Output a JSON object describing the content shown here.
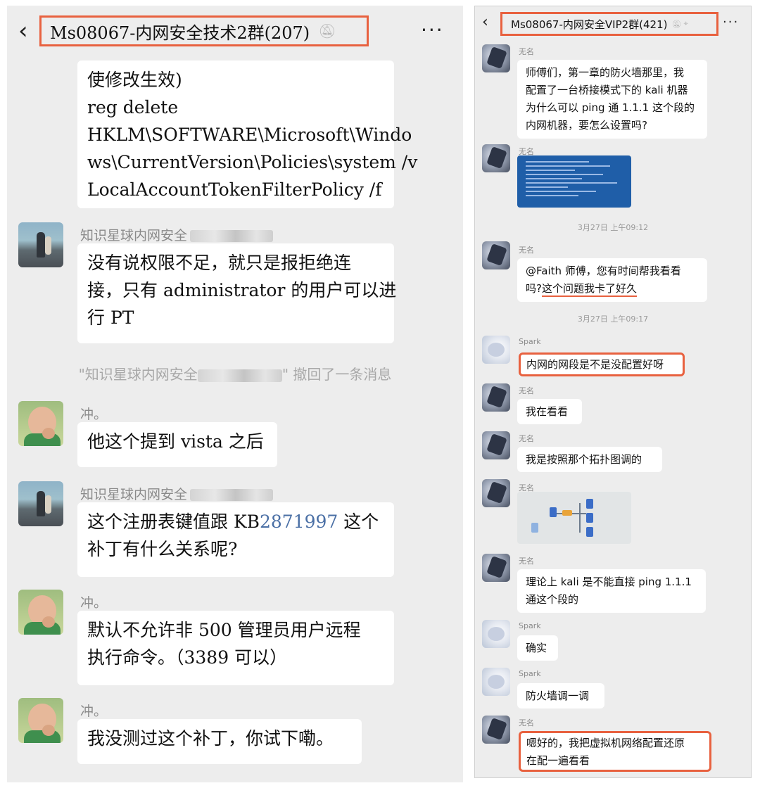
{
  "left": {
    "title": "Ms08067-内网安全技术2群(207)",
    "messages": [
      {
        "lines": [
          "使修改生效)",
          "reg delete",
          "HKLM\\SOFTWARE\\Microsoft\\Windo",
          "ws\\CurrentVersion\\Policies\\system /v",
          "LocalAccountTokenFilterPolicy /f"
        ]
      },
      {
        "sender": "知识星球内网安全",
        "lines": [
          "没有说权限不足，就只是报拒绝连",
          "接，只有 administrator 的用户可以进",
          "行 PT"
        ]
      },
      {
        "sender": "冲。",
        "lines": [
          "他这个提到 vista 之后"
        ]
      },
      {
        "sender": "知识星球内网安全",
        "lines_a": "这个注册表键值跟 KB",
        "link": "2871997",
        "lines_b": " 这个",
        "line2": "补丁有什么关系呢?"
      },
      {
        "sender": "冲。",
        "lines": [
          "默认不允许非 500 管理员用户远程",
          "执行命令。（3389 可以）"
        ]
      },
      {
        "sender": "冲。",
        "lines": [
          "我没测过这个补丁，你试下嘞。"
        ]
      }
    ],
    "recall": {
      "prefix": "\"知识星球内网安全",
      "suffix": "\" 撤回了一条消息"
    }
  },
  "right": {
    "title": "Ms08067-内网安全VIP2群(421)",
    "messages": [
      {
        "sender": "无名",
        "lines": [
          "师傅们，第一章的防火墙那里，我",
          "配置了一台桥接模式下的 kali 机器",
          "为什么可以 ping 通 1.1.1 这个段的",
          "内网机器，要怎么设置吗?"
        ]
      },
      {
        "sender": "无名"
      },
      {
        "sender": "无名",
        "lines": [
          "@Faith  师傅，您有时间帮我看看",
          "吗?"
        ],
        "underlined": "这个问题我卡了好久"
      },
      {
        "sender": "Spark",
        "lines": [
          "内网的网段是不是没配置好呀"
        ]
      },
      {
        "sender": "无名",
        "lines": [
          "我在看看"
        ]
      },
      {
        "sender": "无名",
        "lines": [
          "我是按照那个拓扑图调的"
        ]
      },
      {
        "sender": "无名"
      },
      {
        "sender": "无名",
        "lines": [
          "理论上 kali 是不能直接 ping 1.1.1",
          "通这个段的"
        ]
      },
      {
        "sender": "Spark",
        "lines": [
          "确实"
        ]
      },
      {
        "sender": "Spark",
        "lines": [
          "防火墙调一调"
        ]
      },
      {
        "sender": "无名",
        "lines": [
          "嗯好的，我把虚拟机网络配置还原",
          "在配一遍看看"
        ]
      }
    ],
    "times": [
      "3月27日 上午09:12",
      "3月27日 上午09:17"
    ]
  },
  "icons": {
    "back": "chevron-left-icon",
    "more": "more-horizontal-icon",
    "mute": "bell-off-icon"
  },
  "colors": {
    "highlight": "#e8613f",
    "link": "#4a6fa5",
    "panel_bg": "#ededed",
    "bubble_bg": "#ffffff"
  }
}
